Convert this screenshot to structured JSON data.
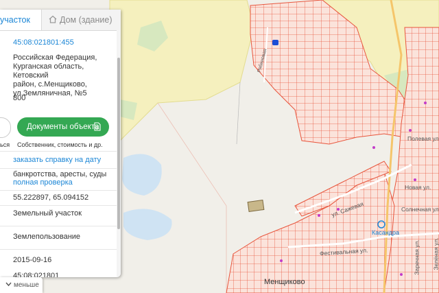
{
  "tabs": {
    "parcel": "участок",
    "building": "Дом (здание)"
  },
  "parcel": {
    "cadastral_number": "45:08:021801:455",
    "address": "Российская Федерация,\nКурганская область, Кетовский\nрайон, с.Менщиково,\nул.Земляничная, №5",
    "area": "800",
    "docs_button": "Документы объекта",
    "docs_caption": "Собственник, стоимость и др.",
    "left_caption": "ься",
    "order_link": "заказать справку на дату",
    "checks_text": "банкротства, аресты, суды",
    "full_check_link": "полная проверка",
    "coordinates": "55.222897, 65.094152",
    "category": "Земельный участок",
    "use_type": "Землепользование",
    "date": "2015-09-16",
    "bottom_cut": "45:08:021801"
  },
  "collapse_button": "меньше",
  "map_labels": {
    "village": "Менщиково",
    "shop": "Касандра",
    "sazhevaya": "ул. Сажевая",
    "festivalnaya": "Фестивальная ул.",
    "novaya": "Новая ул.",
    "solnechnaya": "Солнечная ул.",
    "polevaya": "Полевая ул.",
    "zelenaya": "Зелёная ул.",
    "street_vertical": "Заречная ул.",
    "street_small": "Рябиновая"
  },
  "colors": {
    "parcel_fill": "#fbe2da",
    "parcel_line": "#e8553c",
    "accent": "#1b86d6",
    "button": "#34a853"
  }
}
